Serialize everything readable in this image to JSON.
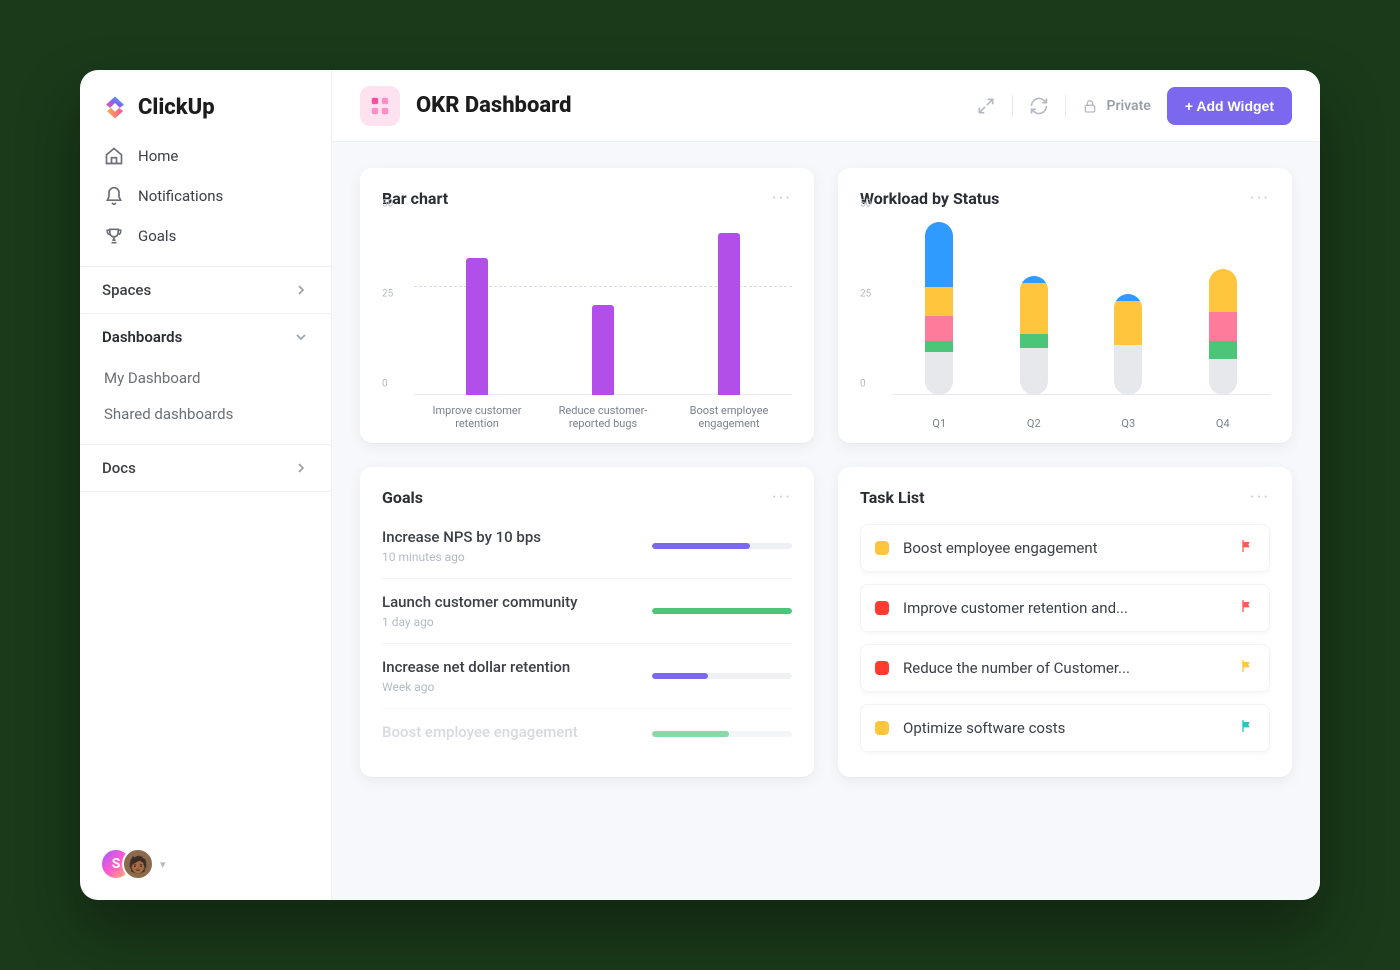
{
  "brand": {
    "name": "ClickUp"
  },
  "sidebar": {
    "home": "Home",
    "notifications": "Notifications",
    "goals": "Goals",
    "spaces": "Spaces",
    "dashboards": "Dashboards",
    "dash_items": {
      "my": "My Dashboard",
      "shared": "Shared dashboards"
    },
    "docs": "Docs",
    "avatar_initial": "S"
  },
  "header": {
    "title": "OKR Dashboard",
    "privacy": "Private",
    "add_widget": "+ Add Widget"
  },
  "cards": {
    "bar": "Bar chart",
    "workload": "Workload by Status",
    "goals": "Goals",
    "tasks": "Task List"
  },
  "goals": [
    {
      "title": "Increase NPS by 10 bps",
      "subtitle": "10 minutes ago",
      "progress": 70,
      "color": "#7b68ee"
    },
    {
      "title": "Launch customer community",
      "subtitle": "1 day ago",
      "progress": 100,
      "color": "#4bc678"
    },
    {
      "title": "Increase net dollar retention",
      "subtitle": "Week ago",
      "progress": 40,
      "color": "#7b68ee"
    },
    {
      "title": "Boost employee engagement",
      "subtitle": "",
      "progress": 55,
      "color": "#4bc678",
      "faded": true
    }
  ],
  "tasks": [
    {
      "chip": "#ffc53d",
      "title": "Boost employee engagement",
      "flag": "#ff5a5a"
    },
    {
      "chip": "#ff3b30",
      "title": "Improve customer retention and...",
      "flag": "#ff5a5a"
    },
    {
      "chip": "#ff3b30",
      "title": "Reduce the number of Customer...",
      "flag": "#ffc53d"
    },
    {
      "chip": "#ffc53d",
      "title": "Optimize software costs",
      "flag": "#29c6b7"
    }
  ],
  "chart_data": [
    {
      "id": "bar",
      "type": "bar",
      "title": "Bar chart",
      "ylim": [
        0,
        50
      ],
      "yticks": [
        0,
        25,
        50
      ],
      "reference_line": 30,
      "categories": [
        "Improve customer retention",
        "Reduce customer-reported bugs",
        "Boost employee engagement"
      ],
      "values": [
        38,
        25,
        45
      ],
      "color": "#b24fe8"
    },
    {
      "id": "workload",
      "type": "stacked-bar",
      "title": "Workload by Status",
      "ylim": [
        0,
        50
      ],
      "yticks": [
        0,
        25,
        50
      ],
      "categories": [
        "Q1",
        "Q2",
        "Q3",
        "Q4"
      ],
      "series": [
        {
          "name": "grey",
          "color": "#e6e8ec",
          "values": [
            12,
            13,
            14,
            10
          ]
        },
        {
          "name": "green",
          "color": "#4bc678",
          "values": [
            3,
            4,
            0,
            5
          ]
        },
        {
          "name": "pink",
          "color": "#ff7b9c",
          "values": [
            7,
            0,
            0,
            8
          ]
        },
        {
          "name": "yellow",
          "color": "#ffc53d",
          "values": [
            8,
            14,
            12,
            12
          ]
        },
        {
          "name": "blue",
          "color": "#2f9bff",
          "values": [
            18,
            2,
            2,
            0
          ]
        }
      ]
    }
  ]
}
